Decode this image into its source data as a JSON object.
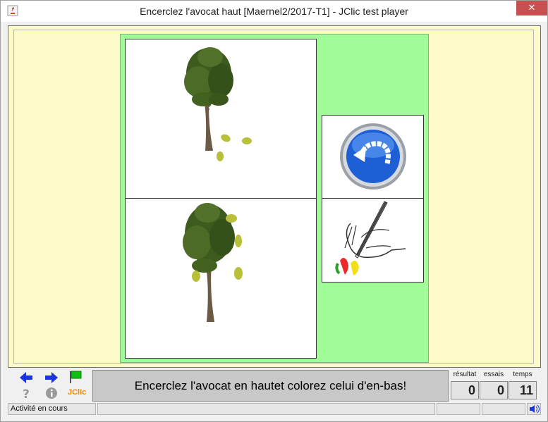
{
  "window": {
    "title": "Encerclez l'avocat haut [Maernel2/2017-T1] - JClic test player",
    "close_glyph": "✕"
  },
  "activity": {
    "message": "Encerclez l'avocat en hautet colorez celui d'en-bas!",
    "cells": [
      {
        "icon": "tree-with-fallen-avocados-icon"
      },
      {
        "icon": "tree-with-hanging-avocados-icon"
      },
      {
        "icon": "undo-round-button-icon"
      },
      {
        "icon": "hand-coloring-pencil-icon"
      }
    ]
  },
  "controls": {
    "brand": "JClic"
  },
  "counters": [
    {
      "label": "résultat",
      "value": "0"
    },
    {
      "label": "essais",
      "value": "0"
    },
    {
      "label": "temps",
      "value": "11"
    }
  ],
  "status": {
    "text": "Activité en cours"
  },
  "colors": {
    "stage_bg": "#fbfac8",
    "board_bg": "#a1fb98",
    "message_bg": "#c8c8c8",
    "close_bg": "#c75050",
    "nav_arrow": "#1a35e0",
    "brand": "#f08a00"
  }
}
